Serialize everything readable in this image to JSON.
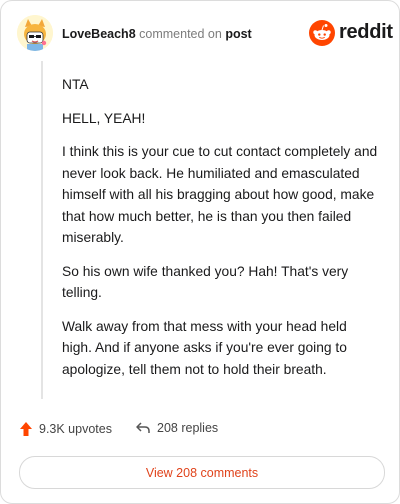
{
  "header": {
    "username": "LoveBeach8",
    "action_text": "commented on",
    "post_link": "post",
    "brand_text": "reddit"
  },
  "comment": {
    "paragraphs": [
      "NTA",
      "HELL, YEAH!",
      "I think this is your cue to cut contact completely and never look back. He humiliated and emasculated himself with all his bragging about how good, make that how much better, he is than you then failed miserably.",
      "So his own wife thanked you? Hah! That's very telling.",
      "Walk away from that mess with your head held high. And if anyone asks if you're ever going to apologize, tell them not to hold their breath."
    ]
  },
  "actions": {
    "upvotes": "9.3K upvotes",
    "replies": "208 replies",
    "view_comments": "View 208 comments"
  },
  "colors": {
    "accent": "#ff4500",
    "link": "#e0431b"
  }
}
